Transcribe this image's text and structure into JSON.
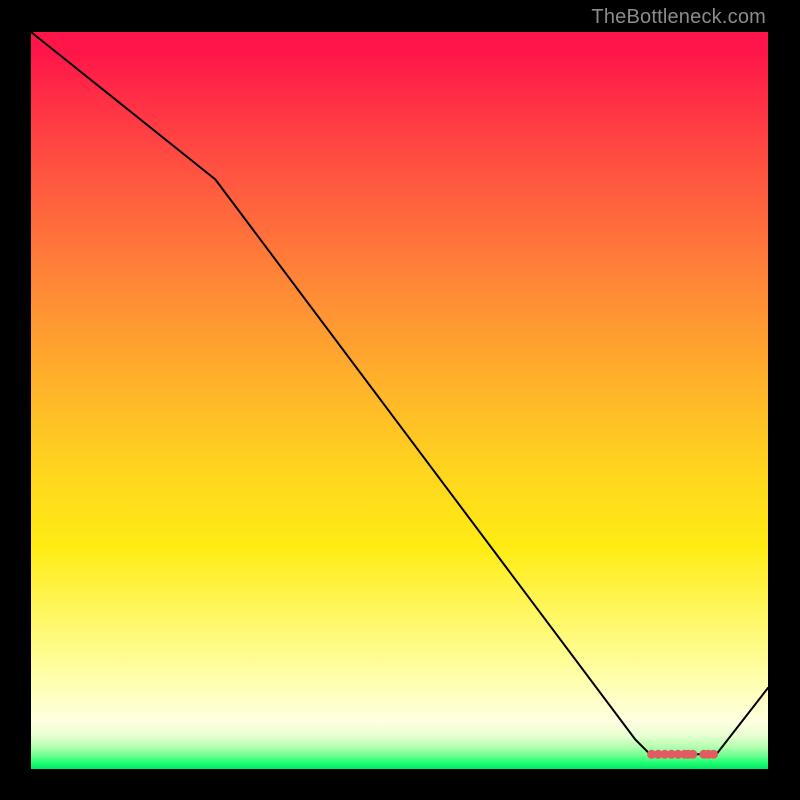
{
  "watermark": "TheBottleneck.com",
  "chart_data": {
    "type": "line",
    "title": "",
    "xlabel": "",
    "ylabel": "",
    "xlim": [
      0,
      100
    ],
    "ylim": [
      0,
      100
    ],
    "grid": false,
    "series": [
      {
        "name": "curve",
        "x": [
          0,
          25,
          82,
          84,
          93,
          100
        ],
        "y": [
          100,
          80,
          4,
          2,
          2,
          11
        ]
      }
    ],
    "markers": {
      "name": "highlight-points",
      "color": "#e35a62",
      "x": [
        84.2,
        85.1,
        86.0,
        86.9,
        87.8,
        88.7,
        89.2,
        89.8,
        91.3,
        91.9,
        92.6
      ],
      "y": [
        2.0,
        2.0,
        2.0,
        2.0,
        2.0,
        2.0,
        2.0,
        2.0,
        2.0,
        2.0,
        2.0
      ]
    },
    "background_gradient": {
      "top": "#ff1649",
      "mid": "#ffe315",
      "bottom": "#00e765"
    }
  }
}
